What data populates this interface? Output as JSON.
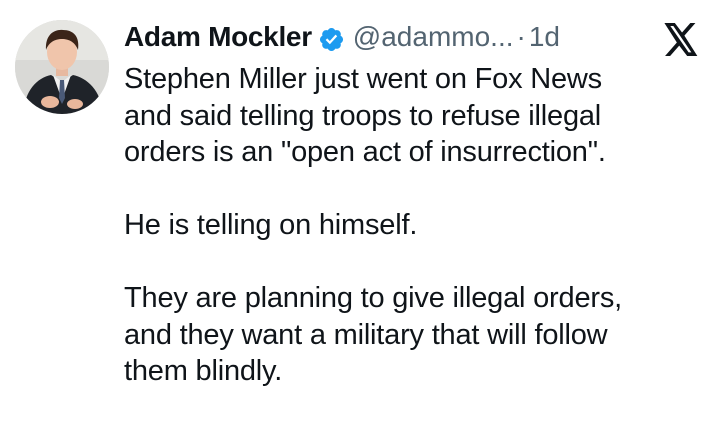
{
  "tweet": {
    "author_name": "Adam Mockler",
    "verified_icon": "verified-badge-icon",
    "handle": "@adammo...",
    "separator": "·",
    "time": "1d",
    "platform_icon": "x-logo-icon",
    "paragraphs": [
      "Stephen Miller just went on Fox News\nand said telling troops to refuse illegal\norders is an \"open act of insurrection\".",
      "He is telling on himself.",
      "They are planning to give illegal orders,\nand they want a military that will follow\nthem blindly."
    ]
  },
  "colors": {
    "text_primary": "#0f1419",
    "text_secondary": "#536471",
    "verified_blue": "#1d9bf0",
    "background": "#ffffff"
  }
}
